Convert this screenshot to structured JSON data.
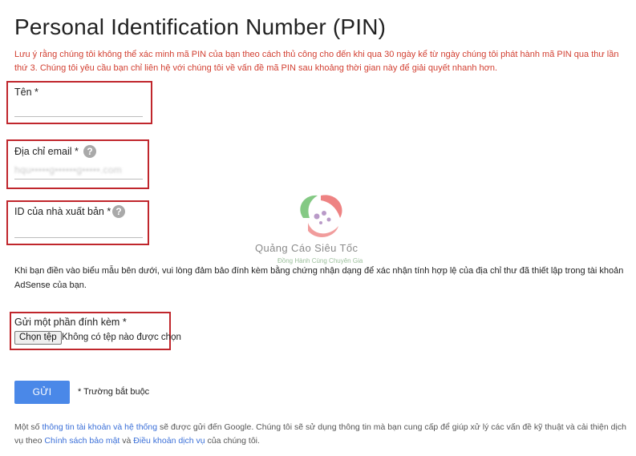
{
  "page": {
    "title": "Personal Identification Number (PIN)",
    "notice": "Lưu ý rằng chúng tôi không thể xác minh mã PIN của bạn theo cách thủ công cho đến khi qua 30 ngày kể từ ngày chúng tôi phát hành mã PIN qua thư lần thứ 3. Chúng tôi yêu cầu bạn chỉ liên hệ với chúng tôi về vấn đề mã PIN sau khoảng thời gian này để giải quyết nhanh hơn."
  },
  "fields": {
    "name": {
      "label": "Tên *",
      "value": ""
    },
    "email": {
      "label": "Địa chỉ email *",
      "value": "hqu•••••g••••••g•••••.com",
      "help_icon": "question-icon"
    },
    "publisher_id": {
      "label": "ID của nhà xuất bản *",
      "value": "",
      "help_icon": "question-icon"
    }
  },
  "description": "Khi bạn điền vào biểu mẫu bên dưới, vui lòng đảm bảo đính kèm bằng chứng nhận dạng để xác nhận tính hợp lệ của địa chỉ thư đã thiết lập trong tài khoản AdSense của bạn.",
  "attachment": {
    "label": "Gửi một phần đính kèm *",
    "button_label": "Chọn tệp",
    "status": "Không có tệp nào được chọn"
  },
  "submit": {
    "label": "GỬI",
    "required_note": "* Trường bắt buộc"
  },
  "footer": {
    "text_1": "Một số ",
    "link_1": "thông tin tài khoản và hệ thống",
    "text_2": " sẽ được gửi đến Google. Chúng tôi sẽ sử dụng thông tin mà bạn cung cấp để giúp xử lý các vấn đề kỹ thuật và cải thiện dịch vụ theo ",
    "link_2": "Chính sách bảo mật",
    "text_3": " và ",
    "link_3": "Điều khoản dịch vụ",
    "text_4": " của chúng tôi."
  },
  "watermark": {
    "name": "Quảng Cáo Siêu Tốc",
    "slogan": "Đồng Hành Cùng Chuyên Gia"
  },
  "colors": {
    "notice_red": "#d23f31",
    "highlight_border": "#c0262c",
    "submit_blue": "#4a88e8",
    "link_blue": "#3a6fd8"
  }
}
